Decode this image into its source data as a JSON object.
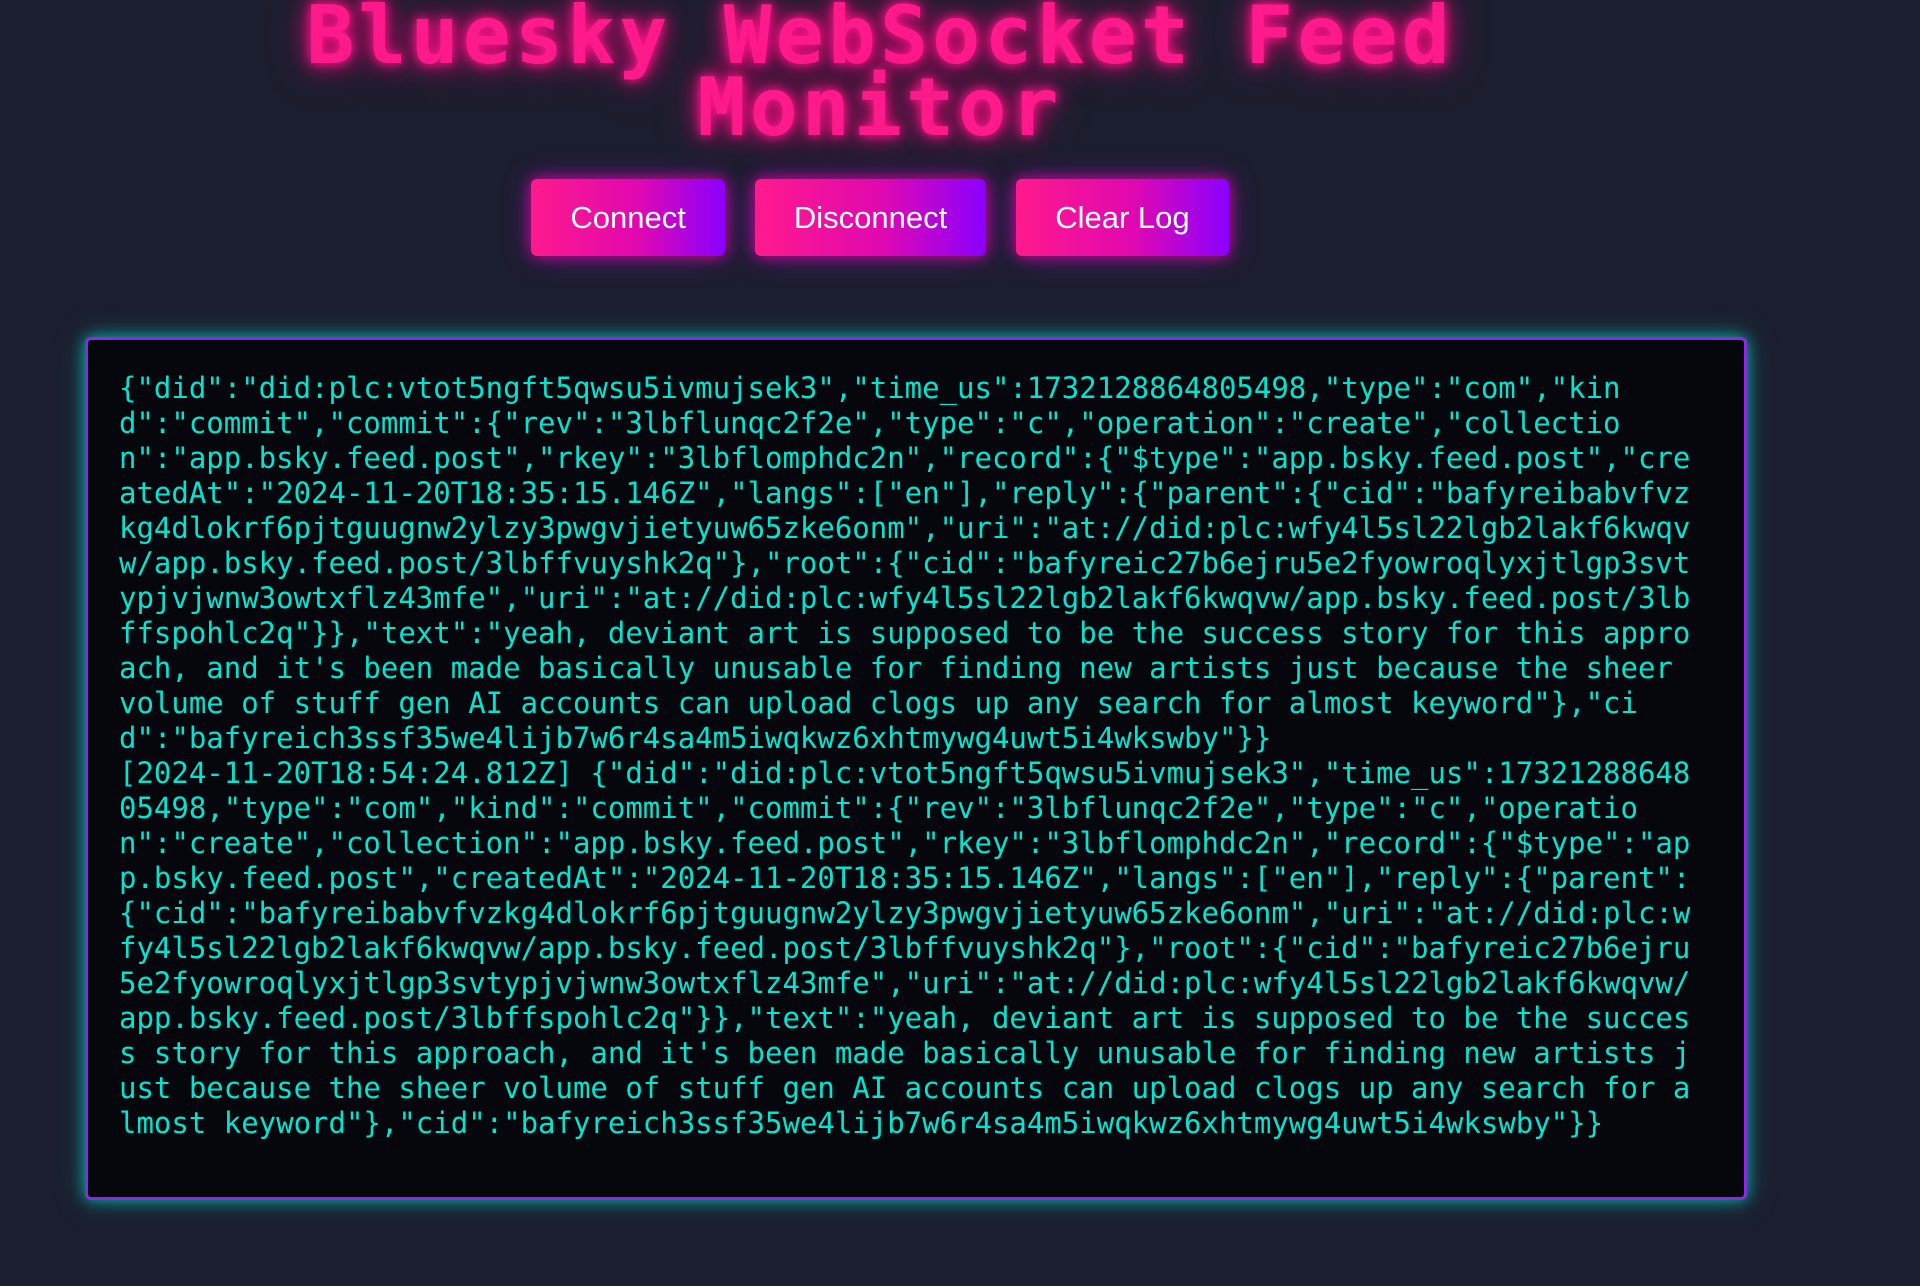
{
  "header": {
    "title_line1": "Bluesky WebSocket Feed",
    "title_line2": "Monitor"
  },
  "controls": {
    "connect_label": "Connect",
    "disconnect_label": "Disconnect",
    "clear_label": "Clear Log"
  },
  "log": {
    "entries": [
      "{\"did\":\"did:plc:vtot5ngft5qwsu5ivmujsek3\",\"time_us\":1732128864805498,\"type\":\"com\",\"kind\":\"commit\",\"commit\":{\"rev\":\"3lbflunqc2f2e\",\"type\":\"c\",\"operation\":\"create\",\"collection\":\"app.bsky.feed.post\",\"rkey\":\"3lbflomphdc2n\",\"record\":{\"$type\":\"app.bsky.feed.post\",\"createdAt\":\"2024-11-20T18:35:15.146Z\",\"langs\":[\"en\"],\"reply\":{\"parent\":{\"cid\":\"bafyreibabvfvzkg4dlokrf6pjtguugnw2ylzy3pwgvjietyuw65zke6onm\",\"uri\":\"at://did:plc:wfy4l5sl22lgb2lakf6kwqvw/app.bsky.feed.post/3lbffvuyshk2q\"},\"root\":{\"cid\":\"bafyreic27b6ejru5e2fyowroqlyxjtlgp3svtypjvjwnw3owtxflz43mfe\",\"uri\":\"at://did:plc:wfy4l5sl22lgb2lakf6kwqvw/app.bsky.feed.post/3lbffspohlc2q\"}},\"text\":\"yeah, deviant art is supposed to be the success story for this approach, and it's been made basically unusable for finding new artists just because the sheer volume of stuff gen AI accounts can upload clogs up any search for almost keyword\"},\"cid\":\"bafyreich3ssf35we4lijb7w6r4sa4m5iwqkwz6xhtmywg4uwt5i4wkswby\"}}",
      "[2024-11-20T18:54:24.812Z] {\"did\":\"did:plc:vtot5ngft5qwsu5ivmujsek3\",\"time_us\":1732128864805498,\"type\":\"com\",\"kind\":\"commit\",\"commit\":{\"rev\":\"3lbflunqc2f2e\",\"type\":\"c\",\"operation\":\"create\",\"collection\":\"app.bsky.feed.post\",\"rkey\":\"3lbflomphdc2n\",\"record\":{\"$type\":\"app.bsky.feed.post\",\"createdAt\":\"2024-11-20T18:35:15.146Z\",\"langs\":[\"en\"],\"reply\":{\"parent\":{\"cid\":\"bafyreibabvfvzkg4dlokrf6pjtguugnw2ylzy3pwgvjietyuw65zke6onm\",\"uri\":\"at://did:plc:wfy4l5sl22lgb2lakf6kwqvw/app.bsky.feed.post/3lbffvuyshk2q\"},\"root\":{\"cid\":\"bafyreic27b6ejru5e2fyowroqlyxjtlgp3svtypjvjwnw3owtxflz43mfe\",\"uri\":\"at://did:plc:wfy4l5sl22lgb2lakf6kwqvw/app.bsky.feed.post/3lbffspohlc2q\"}},\"text\":\"yeah, deviant art is supposed to be the success story for this approach, and it's been made basically unusable for finding new artists just because the sheer volume of stuff gen AI accounts can upload clogs up any search for almost keyword\"},\"cid\":\"bafyreich3ssf35we4lijb7w6r4sa4m5iwqkwz6xhtmywg4uwt5i4wkswby\"}}"
    ]
  }
}
